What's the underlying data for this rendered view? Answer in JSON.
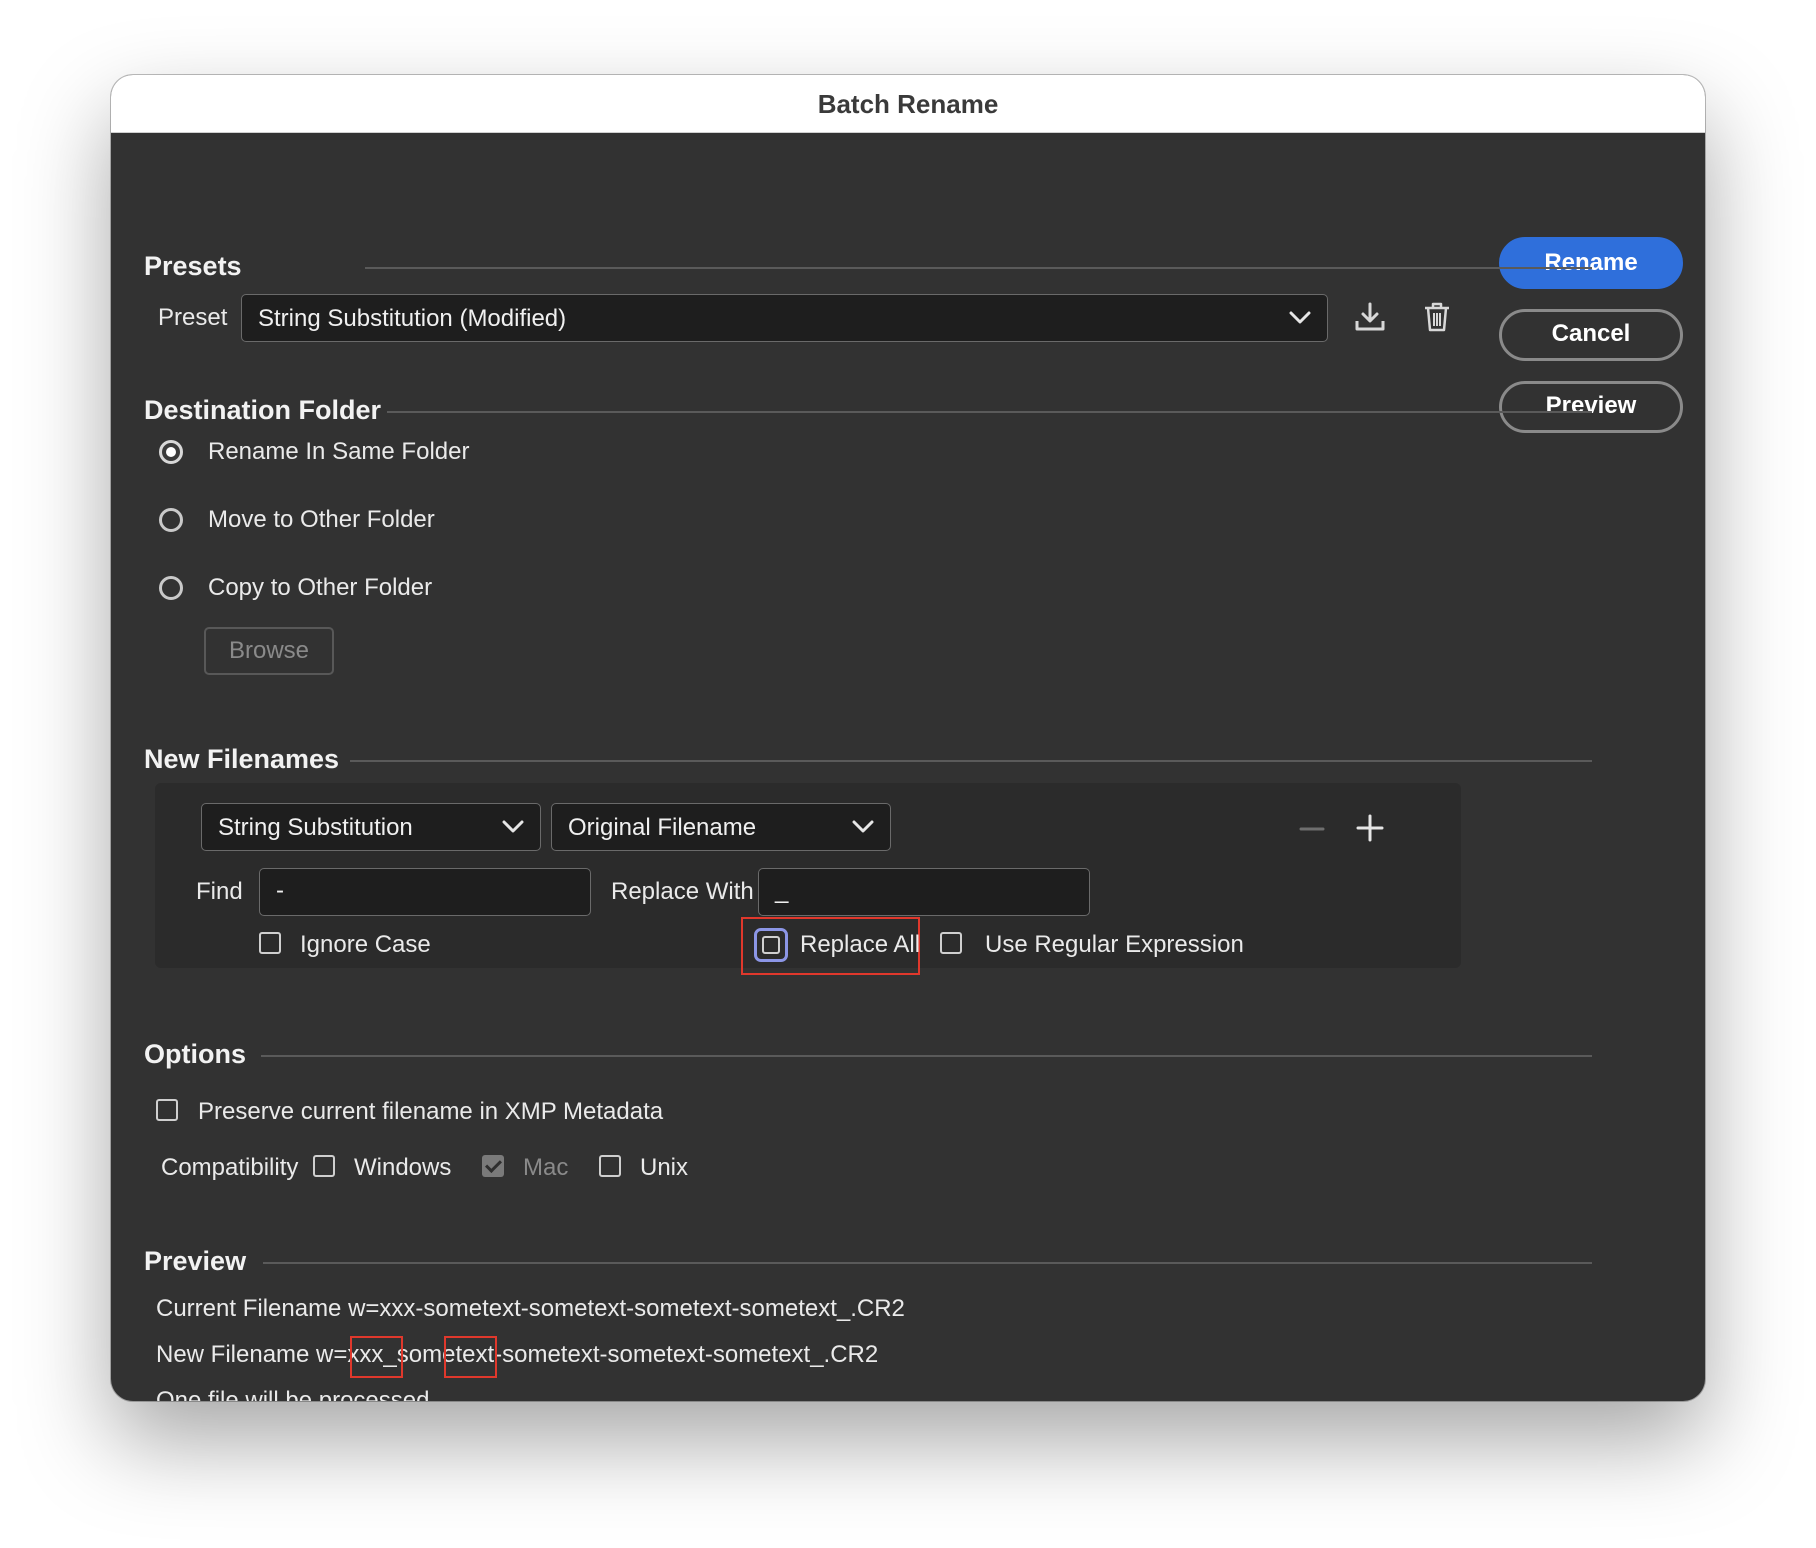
{
  "window": {
    "title": "Batch Rename"
  },
  "buttons": {
    "rename": "Rename",
    "cancel": "Cancel",
    "preview": "Preview"
  },
  "presets": {
    "title": "Presets",
    "preset_label": "Preset",
    "preset_value": "String Substitution (Modified)"
  },
  "destination": {
    "title": "Destination Folder",
    "options": [
      "Rename In Same Folder",
      "Move to Other Folder",
      "Copy to Other Folder"
    ],
    "selected_index": 0,
    "browse_label": "Browse"
  },
  "new_filenames": {
    "title": "New Filenames",
    "type_value": "String Substitution",
    "source_value": "Original Filename",
    "find_label": "Find",
    "find_value": "-",
    "replace_label": "Replace With",
    "replace_value": "_",
    "ignore_case_label": "Ignore Case",
    "ignore_case_checked": false,
    "replace_all_label": "Replace All",
    "replace_all_checked": false,
    "regex_label": "Use Regular Expression",
    "regex_checked": false
  },
  "options": {
    "title": "Options",
    "preserve_label": "Preserve current filename in XMP Metadata",
    "preserve_checked": false,
    "compatibility_label": "Compatibility",
    "windows_label": "Windows",
    "windows_checked": false,
    "mac_label": "Mac",
    "mac_checked": true,
    "unix_label": "Unix",
    "unix_checked": false
  },
  "preview": {
    "title": "Preview",
    "current_line": "Current Filename w=xxx-sometext-sometext-sometext-sometext_.CR2",
    "new_line": "New Filename w=xxx_sometext-sometext-sometext-sometext_.CR2",
    "count_line": "One file will be processed"
  },
  "colors": {
    "accent": "#2f6fdb",
    "highlight": "#e0382c",
    "focus": "#8c96e6",
    "background": "#323232"
  },
  "icons": {
    "save_preset": "download-icon",
    "delete_preset": "trash-icon",
    "add_rule": "plus-icon",
    "remove_rule": "minus-icon",
    "dropdown": "chevron-down-icon"
  }
}
